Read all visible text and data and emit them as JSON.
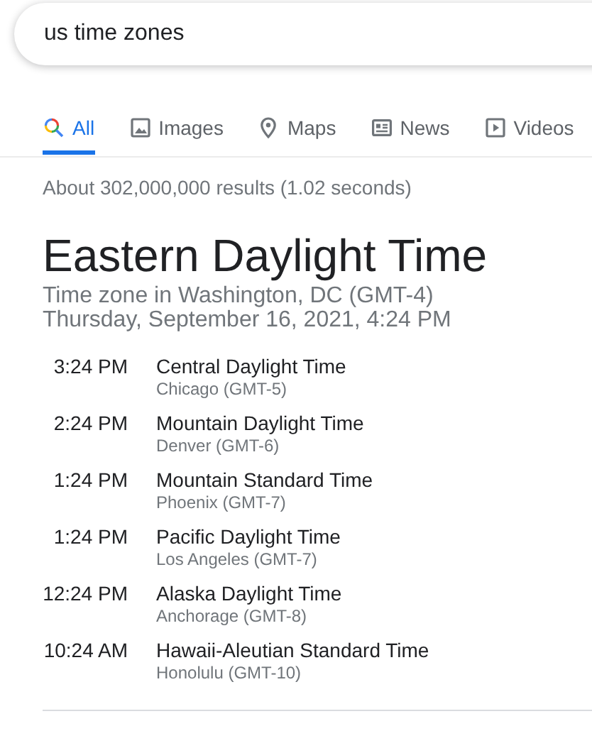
{
  "search": {
    "value": "us time zones"
  },
  "tabs": [
    {
      "label": "All",
      "kind": "all",
      "selected": true
    },
    {
      "label": "Images",
      "kind": "images",
      "selected": false
    },
    {
      "label": "Maps",
      "kind": "maps",
      "selected": false
    },
    {
      "label": "News",
      "kind": "news",
      "selected": false
    },
    {
      "label": "Videos",
      "kind": "videos",
      "selected": false
    }
  ],
  "result_stats": "About 302,000,000 results (1.02 seconds)",
  "card": {
    "title": "Eastern Daylight Time",
    "subtitle": "Time zone in Washington, DC (GMT-4)",
    "datetime": "Thursday, September 16, 2021, 4:24 PM",
    "zones": [
      {
        "time": "3:24 PM",
        "name": "Central Daylight Time",
        "city": "Chicago (GMT-5)"
      },
      {
        "time": "2:24 PM",
        "name": "Mountain Daylight Time",
        "city": "Denver (GMT-6)"
      },
      {
        "time": "1:24 PM",
        "name": "Mountain Standard Time",
        "city": "Phoenix (GMT-7)"
      },
      {
        "time": "1:24 PM",
        "name": "Pacific Daylight Time",
        "city": "Los Angeles (GMT-7)"
      },
      {
        "time": "12:24 PM",
        "name": "Alaska Daylight Time",
        "city": "Anchorage (GMT-8)"
      },
      {
        "time": "10:24 AM",
        "name": "Hawaii-Aleutian Standard Time",
        "city": "Honolulu (GMT-10)"
      }
    ]
  }
}
